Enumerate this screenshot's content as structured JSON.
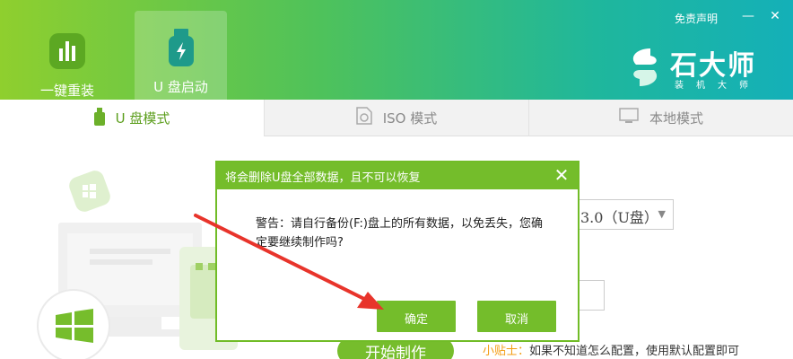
{
  "header": {
    "nav": [
      {
        "label": "一键重装",
        "icon": "bar-chart-icon"
      },
      {
        "label": "U 盘启动",
        "icon": "usb-drive-icon"
      }
    ],
    "disclaimer": "免责声明",
    "minimize": "—",
    "close": "✕",
    "logo": {
      "name": "石大师",
      "sub": "装机大师"
    }
  },
  "mode_tabs": [
    {
      "label": "U 盘模式",
      "icon": "usb-icon",
      "active": true
    },
    {
      "label": "ISO 模式",
      "icon": "iso-file-icon",
      "active": false
    },
    {
      "label": "本地模式",
      "icon": "monitor-icon",
      "active": false
    }
  ],
  "main": {
    "device_select_value": "3.0（U盘）",
    "start_button": "开始制作",
    "tip_label": "小贴士：",
    "tip_text": "如果不知道怎么配置，使用默认配置即可"
  },
  "dialog": {
    "title": "将会删除U盘全部数据，且不可以恢复",
    "close": "✕",
    "message": "警告：请自行备份(F:)盘上的所有数据，以免丢失，您确定要继续制作吗?",
    "ok": "确定",
    "cancel": "取消"
  },
  "colors": {
    "accent_green": "#74bd2b",
    "header_gradient_start": "#8fcf2e",
    "header_gradient_end": "#14b0b8",
    "tip_orange": "#f39c12",
    "annotation_arrow": "#e8342b"
  }
}
